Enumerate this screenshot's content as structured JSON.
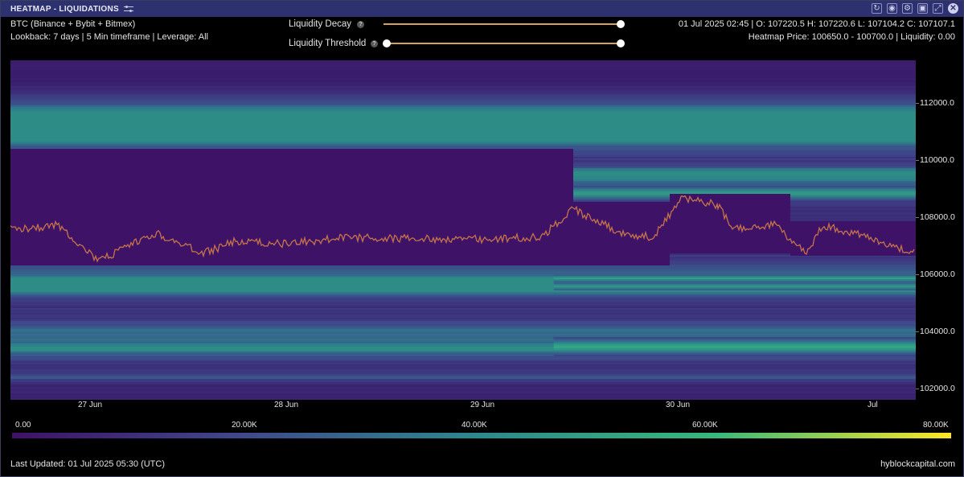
{
  "window": {
    "title": "HEATMAP - LIQUIDATIONS",
    "icons": [
      "refresh-icon",
      "camera-icon",
      "gear-icon",
      "save-icon",
      "expand-icon",
      "close-icon"
    ]
  },
  "info": {
    "exchanges": "BTC (Binance + Bybit + Bitmex)",
    "lookback": "Lookback: 7 days | 5 Min timeframe | Leverage: All",
    "ohlc": "01 Jul 2025 02:45 | O: 107220.5 H: 107220.6 L: 107104.2 C: 107107.1",
    "heatmap_price": "Heatmap Price: 100650.0 - 100700.0 | Liquidity: 0.00"
  },
  "controls": {
    "decay_label": "Liquidity Decay",
    "threshold_label": "Liquidity Threshold",
    "decay_value": 1.0,
    "threshold_range": [
      0.0,
      1.0
    ]
  },
  "chart": {
    "y_ticks": [
      "112000.0",
      "110000.0",
      "108000.0",
      "106000.0",
      "104000.0",
      "102000.0"
    ],
    "x_ticks": [
      "27 Jun",
      "28 Jun",
      "29 Jun",
      "30 Jun",
      "Jul"
    ]
  },
  "colorbar": {
    "labels": [
      "0.00",
      "20.00K",
      "40.00K",
      "60.00K",
      "80.00K"
    ]
  },
  "footer": {
    "updated": "Last Updated: 01 Jul 2025 05:30 (UTC)",
    "brand": "hyblockcapital.com"
  },
  "colors": {
    "titlebar": "#2e3170",
    "slider_track": "#d7a35a",
    "price_line": "#d9a15a",
    "low": "#3f1168",
    "high": "#fde725"
  }
}
